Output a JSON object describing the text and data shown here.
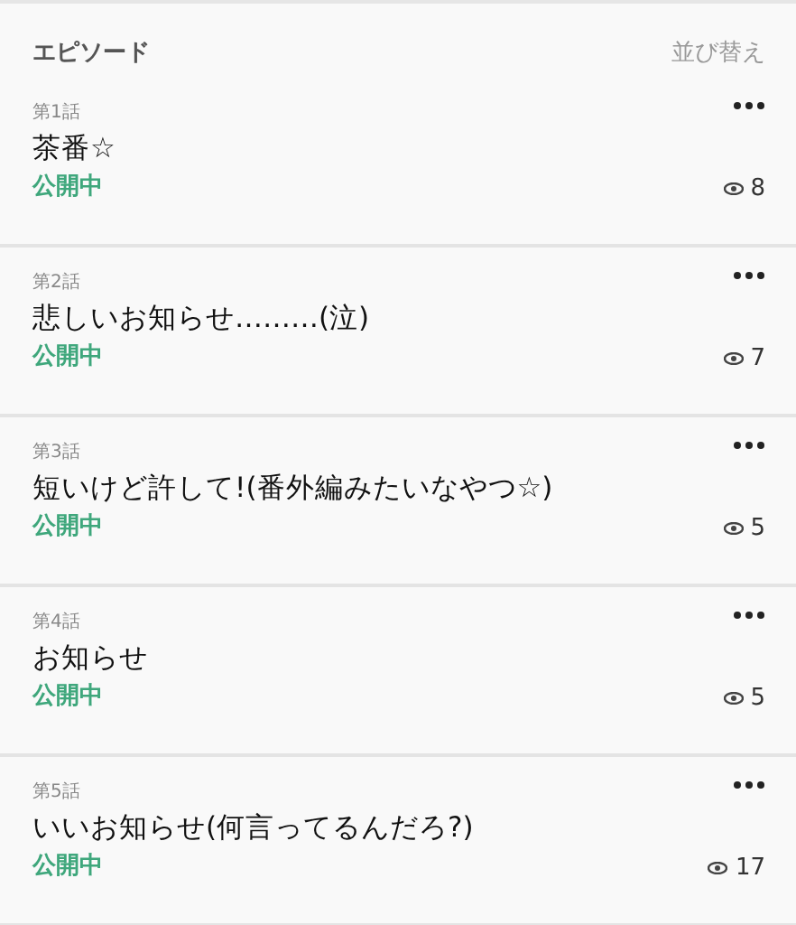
{
  "header": {
    "title": "エピソード",
    "sort_link": "並び替え"
  },
  "episodes": [
    {
      "number": "第1話",
      "title": "茶番☆",
      "status": "公開中",
      "views": "8"
    },
    {
      "number": "第2話",
      "title": "悲しいお知らせ………(泣)",
      "status": "公開中",
      "views": "7"
    },
    {
      "number": "第3話",
      "title": "短いけど許して!(番外編みたいなやつ☆)",
      "status": "公開中",
      "views": "5"
    },
    {
      "number": "第4話",
      "title": "お知らせ",
      "status": "公開中",
      "views": "5"
    },
    {
      "number": "第5話",
      "title": "いいお知らせ(何言ってるんだろ?)",
      "status": "公開中",
      "views": "17"
    }
  ]
}
